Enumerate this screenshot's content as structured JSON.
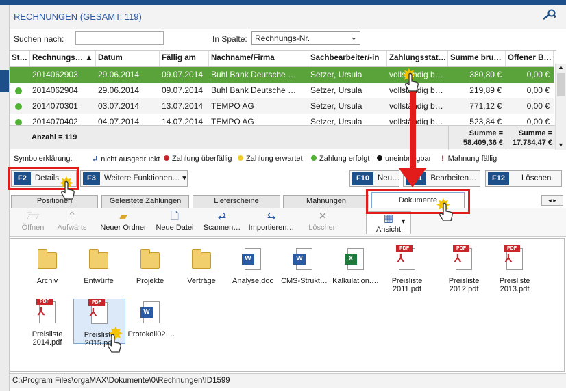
{
  "header": {
    "title": "RECHNUNGEN (GESAMT: 119)",
    "search_icon": "search-key-icon"
  },
  "search": {
    "label": "Suchen nach:",
    "value": "",
    "column_label": "In Spalte:",
    "column_value": "Rechnungs-Nr."
  },
  "grid": {
    "columns": [
      "St…",
      "Rechnungs… ▲",
      "Datum",
      "Fällig am",
      "Nachname/Firma",
      "Sachbearbeiter/-in",
      "Zahlungsstat…",
      "Summe bru…",
      "Offener B…"
    ],
    "rows": [
      [
        "",
        "2014062903",
        "29.06.2014",
        "09.07.2014",
        "Buhl Bank Deutsche …",
        "Setzer, Ursula",
        "vollständig b…",
        "380,80 €",
        "0,00 €"
      ],
      [
        "",
        "2014062904",
        "29.06.2014",
        "09.07.2014",
        "Buhl Bank Deutsche …",
        "Setzer, Ursula",
        "vollständig b…",
        "219,89 €",
        "0,00 €"
      ],
      [
        "",
        "2014070301",
        "03.07.2014",
        "13.07.2014",
        "TEMPO AG",
        "Setzer, Ursula",
        "vollständig b…",
        "771,12 €",
        "0,00 €"
      ],
      [
        "",
        "2014070402",
        "04.07.2014",
        "14.07.2014",
        "TEMPO AG",
        "Setzer, Ursula",
        "vollständig b…",
        "523,84 €",
        "0,00 €"
      ]
    ],
    "footer": {
      "count": "Anzahl = 119",
      "sum_gross_label": "Summe =",
      "sum_gross": "58.409,36 €",
      "sum_open_label": "Summe =",
      "sum_open": "17.784,47 €"
    }
  },
  "legend": {
    "title": "Symbolerklärung:",
    "items": [
      {
        "label": "nicht ausgedruckt",
        "color": "#2b5aa5",
        "icon": "arrow-return-icon"
      },
      {
        "label": "Zahlung überfällig",
        "color": "#c8262b"
      },
      {
        "label": "Zahlung erwartet",
        "color": "#f2cc2a"
      },
      {
        "label": "Zahlung erfolgt",
        "color": "#4fb233"
      },
      {
        "label": "uneinbringbar",
        "color": "#111111"
      },
      {
        "label": "Mahnung fällig",
        "color": "#c8262b",
        "icon": "exclamation-icon"
      }
    ]
  },
  "actions": {
    "details": {
      "key": "F2",
      "label": "Details"
    },
    "more": {
      "key": "F3",
      "label": "Weitere Funktionen…"
    },
    "new": {
      "key": "F10",
      "label": "Neu…"
    },
    "edit": {
      "key": "F11",
      "label": "Bearbeiten…"
    },
    "delete": {
      "key": "F12",
      "label": "Löschen"
    }
  },
  "tabs": [
    "Positionen",
    "Geleistete Zahlungen",
    "Lieferscheine",
    "Mahnungen",
    "Dokumente"
  ],
  "toolbar": {
    "open": "Öffnen",
    "up": "Aufwärts",
    "new_folder": "Neuer Ordner",
    "new_file": "Neue Datei",
    "scan": "Scannen…",
    "import": "Importieren…",
    "delete": "Löschen",
    "view": "Ansicht"
  },
  "files": [
    {
      "name": "Archiv",
      "type": "folder"
    },
    {
      "name": "Entwürfe",
      "type": "folder"
    },
    {
      "name": "Projekte",
      "type": "folder"
    },
    {
      "name": "Verträge",
      "type": "folder"
    },
    {
      "name": "Analyse.doc",
      "type": "word"
    },
    {
      "name": "CMS-Strukt…",
      "type": "word"
    },
    {
      "name": "Kalkulation.…",
      "type": "excel"
    },
    {
      "name": "Preisliste 2011.pdf",
      "type": "pdf"
    },
    {
      "name": "Preisliste 2012.pdf",
      "type": "pdf"
    },
    {
      "name": "Preisliste 2013.pdf",
      "type": "pdf"
    },
    {
      "name": "Preisliste 2014.pdf",
      "type": "pdf"
    },
    {
      "name": "Preisliste 2015.pdf",
      "type": "pdf"
    },
    {
      "name": "Protokoll02.…",
      "type": "word"
    }
  ],
  "status": {
    "path": "C:\\Program Files\\orgaMAX\\Dokumente\\0\\Rechnungen\\ID1599"
  },
  "colors": {
    "accent": "#1d4f8a",
    "selected_row": "#5aa33b",
    "highlight": "#e21b1b"
  }
}
